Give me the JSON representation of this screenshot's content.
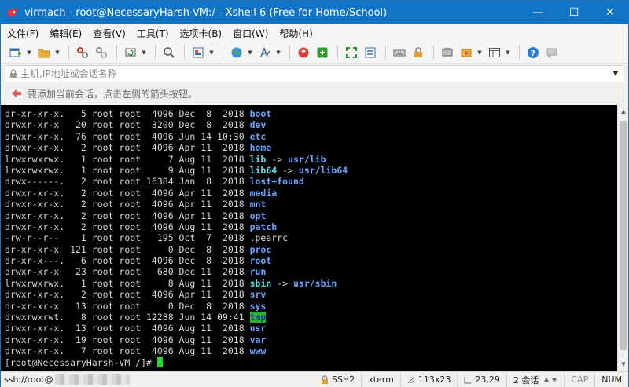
{
  "window": {
    "title": "virmach - root@NecessaryHarsh-VM:/ - Xshell 6 (Free for Home/School)",
    "controls": {
      "minimize": "—",
      "maximize": "☐",
      "close": "✕"
    }
  },
  "menu": {
    "items": [
      {
        "label": "文件(F)"
      },
      {
        "label": "编辑(E)"
      },
      {
        "label": "查看(V)"
      },
      {
        "label": "工具(T)"
      },
      {
        "label": "选项卡(B)"
      },
      {
        "label": "窗口(W)"
      },
      {
        "label": "帮助(H)"
      }
    ]
  },
  "address": {
    "placeholder": "主机,IP地址或会话名称"
  },
  "hint": {
    "text": "要添加当前会话，点击左侧的箭头按钮。"
  },
  "terminal": {
    "lines": [
      {
        "meta": "dr-xr-xr-x.   5 root root  4096 Dec  8  2018 ",
        "name": "boot",
        "type": "dir"
      },
      {
        "meta": "drwxr-xr-x   20 root root  3200 Dec  8  2018 ",
        "name": "dev",
        "type": "dir"
      },
      {
        "meta": "drwxr-xr-x.  76 root root  4096 Jun 14 10:30 ",
        "name": "etc",
        "type": "dir"
      },
      {
        "meta": "drwxr-xr-x.   2 root root  4096 Apr 11  2018 ",
        "name": "home",
        "type": "dir"
      },
      {
        "meta": "lrwxrwxrwx.   1 root root     7 Aug 11  2018 ",
        "name": "lib",
        "type": "link",
        "target": "usr/lib"
      },
      {
        "meta": "lrwxrwxrwx.   1 root root     9 Aug 11  2018 ",
        "name": "lib64",
        "type": "link",
        "target": "usr/lib64"
      },
      {
        "meta": "drwx------.   2 root root 16384 Jan  8  2018 ",
        "name": "lost+found",
        "type": "dir"
      },
      {
        "meta": "drwxr-xr-x.   2 root root  4096 Apr 11  2018 ",
        "name": "media",
        "type": "dir"
      },
      {
        "meta": "drwxr-xr-x.   2 root root  4096 Apr 11  2018 ",
        "name": "mnt",
        "type": "dir"
      },
      {
        "meta": "drwxr-xr-x.   2 root root  4096 Apr 11  2018 ",
        "name": "opt",
        "type": "dir"
      },
      {
        "meta": "drwxr-xr-x.   2 root root  4096 Aug 11  2018 ",
        "name": "patch",
        "type": "dir"
      },
      {
        "meta": "-rw-r--r--    1 root root   195 Oct  7  2018 ",
        "name": ".pearrc",
        "type": "file"
      },
      {
        "meta": "dr-xr-xr-x  121 root root     0 Dec  8  2018 ",
        "name": "proc",
        "type": "dir"
      },
      {
        "meta": "dr-xr-x---.   6 root root  4096 Dec  8  2018 ",
        "name": "root",
        "type": "dir"
      },
      {
        "meta": "drwxr-xr-x   23 root root   680 Dec 11  2018 ",
        "name": "run",
        "type": "dir"
      },
      {
        "meta": "lrwxrwxrwx.   1 root root     8 Aug 11  2018 ",
        "name": "sbin",
        "type": "link",
        "target": "usr/sbin"
      },
      {
        "meta": "drwxr-xr-x.   2 root root  4096 Apr 11  2018 ",
        "name": "srv",
        "type": "dir"
      },
      {
        "meta": "dr-xr-xr-x   13 root root     0 Dec  8  2018 ",
        "name": "sys",
        "type": "dir"
      },
      {
        "meta": "drwxrwxrwt.   8 root root 12288 Jun 14 09:41 ",
        "name": "tmp",
        "type": "sticky"
      },
      {
        "meta": "drwxr-xr-x.  13 root root  4096 Aug 11  2018 ",
        "name": "usr",
        "type": "dir"
      },
      {
        "meta": "drwxr-xr-x.  19 root root  4096 Aug 11  2018 ",
        "name": "var",
        "type": "dir"
      },
      {
        "meta": "drwxr-xr-x.   7 root root  4096 Aug 11  2018 ",
        "name": "www",
        "type": "dir"
      }
    ],
    "prompt": "[root@NecessaryHarsh-VM /]# ",
    "link_arrow": " -> "
  },
  "status": {
    "host": "ssh://root@",
    "protocol": "SSH2",
    "terminal_type": "xterm",
    "size": "113x23",
    "cursor_pos": "23,29",
    "sessions": "2 会话",
    "cap": "CAP",
    "num": "NUM"
  },
  "colors": {
    "titlebar": "#1174c6",
    "terminal_bg": "#000000",
    "dir": "#6aa6ff",
    "link": "#5fe0e6",
    "cursor": "#25d625"
  }
}
